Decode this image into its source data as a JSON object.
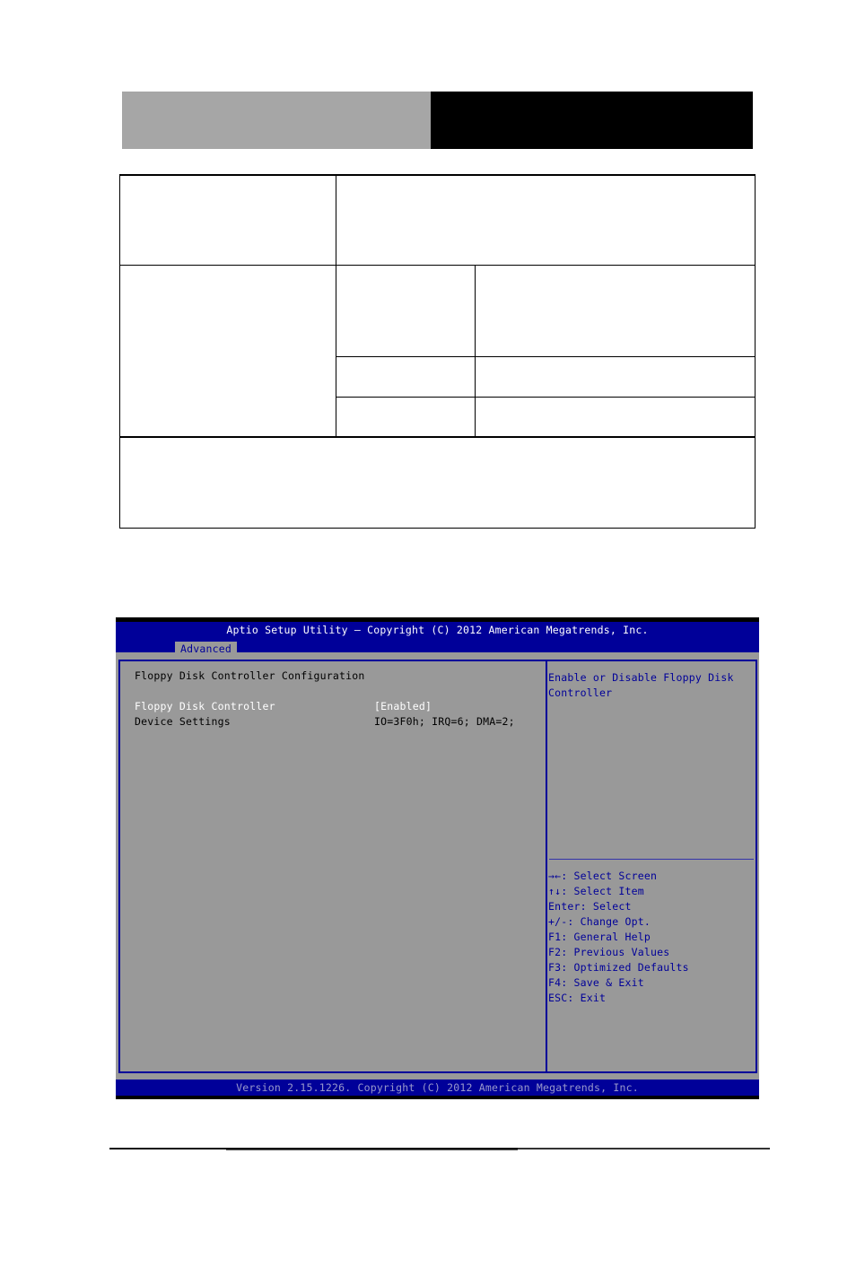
{
  "bios": {
    "title": "Aptio Setup Utility – Copyright (C) 2012 American Megatrends, Inc.",
    "active_tab": "Advanced",
    "section_title": "Floppy Disk Controller Configuration",
    "settings": [
      {
        "label": "Floppy Disk Controller",
        "value": "[Enabled]",
        "selected": true
      },
      {
        "label": "Device Settings",
        "value": "IO=3F0h; IRQ=6; DMA=2;",
        "selected": false
      }
    ],
    "help_text": "Enable or Disable Floppy Disk Controller",
    "key_help": [
      "→←: Select Screen",
      "↑↓: Select Item",
      "Enter: Select",
      "+/-: Change Opt.",
      "F1: General Help",
      "F2: Previous Values",
      "F3: Optimized Defaults",
      "F4: Save & Exit",
      "ESC: Exit"
    ],
    "footer": "Version 2.15.1226. Copyright (C) 2012 American Megatrends, Inc.",
    "colors": {
      "header_bg": "#000099",
      "panel_bg": "#999999",
      "highlight_text": "#ffffff",
      "help_text": "#000099"
    }
  }
}
